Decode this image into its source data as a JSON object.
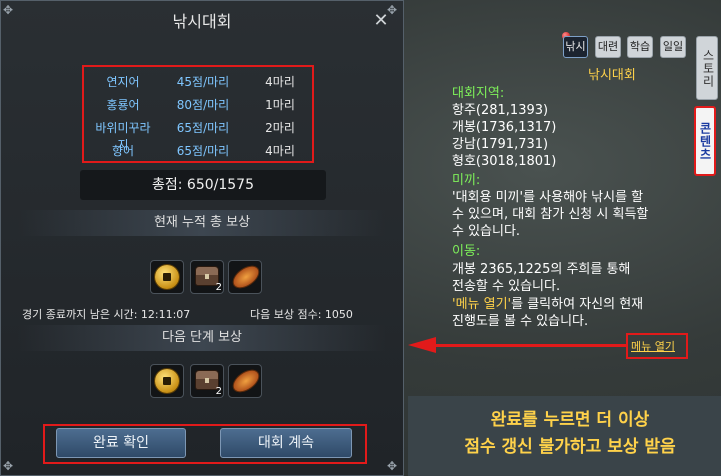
{
  "dialog": {
    "title": "낚시대회",
    "fish": [
      {
        "name": "연지어",
        "points": "45점/마리",
        "count": "4마리"
      },
      {
        "name": "홍룡어",
        "points": "80점/마리",
        "count": "1마리"
      },
      {
        "name": "바위미꾸라지",
        "points": "65점/마리",
        "count": "2마리"
      },
      {
        "name": "향어",
        "points": "65점/마리",
        "count": "4마리"
      }
    ],
    "total": "총점: 650/1575",
    "current_reward_header": "현재 누적 총 보상",
    "current_rewards": [
      {
        "icon": "gold-coin-icon",
        "count": ""
      },
      {
        "icon": "treasure-chest-icon",
        "count": "2"
      },
      {
        "icon": "bread-icon",
        "count": ""
      }
    ],
    "time_remaining": "경기 종료까지 남은 시간: 12:11:07",
    "reward_points": "다음 보상 점수: 1050",
    "next_reward_header": "다음 단계 보상",
    "next_rewards": [
      {
        "icon": "gold-coin-icon",
        "count": ""
      },
      {
        "icon": "treasure-chest-icon",
        "count": "2"
      },
      {
        "icon": "bread-icon",
        "count": ""
      }
    ],
    "confirm_button": "완료 확인",
    "continue_button": "대회 계속"
  },
  "panel": {
    "tabs": [
      "낚시",
      "대련",
      "학습",
      "일일"
    ],
    "side_tabs": {
      "story": "스토리",
      "content": "콘텐츠"
    },
    "title": "낚시대회",
    "region_label": "대회지역:",
    "regions": [
      "항주(281,1393)",
      "개봉(1736,1317)",
      "강남(1791,731)",
      "형호(3018,1801)"
    ],
    "bait_label": "미끼:",
    "bait_text": [
      "'대회용 미끼'를 사용해야 낚시를 할",
      "수 있으며, 대회 참가 신청 시 획득할",
      "수 있습니다."
    ],
    "move_label": "이동:",
    "move_text": [
      "개봉 2365,1225의 주희를 통해",
      "전송할 수 있습니다."
    ],
    "menu_hl": "'메뉴 열기'",
    "menu_text_1": "를 클릭하여 자신의 현재",
    "menu_text_2": "진행도를 볼 수 있습니다.",
    "menu_link": "메뉴 열기"
  },
  "caption": {
    "line1": "완료를 누르면 더 이상",
    "line2": "점수 갱신 불가하고 보상 받음"
  },
  "colors": {
    "highlight_red": "#e11a1a",
    "quest_yellow": "#ffd24a",
    "quest_green": "#7ef05a",
    "fish_blue": "#7fc6ff"
  }
}
